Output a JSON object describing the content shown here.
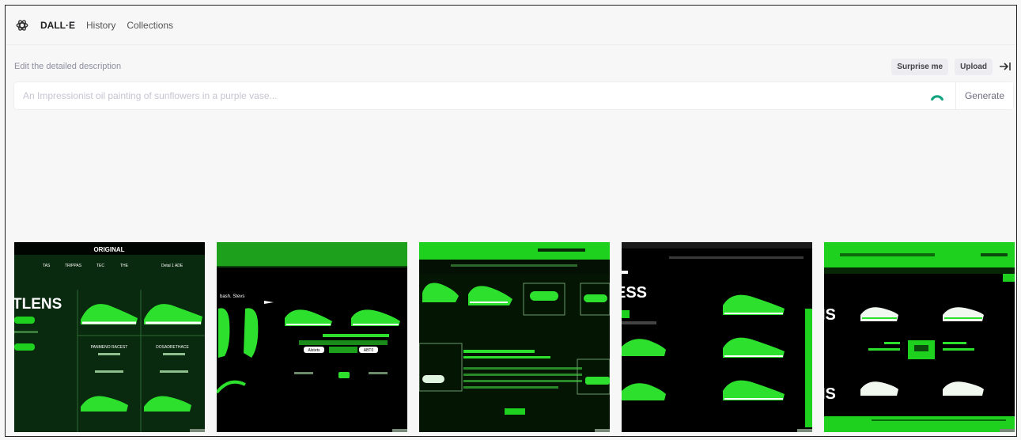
{
  "nav": {
    "brand": "DALL·E",
    "items": [
      "History",
      "Collections"
    ]
  },
  "prompt": {
    "label": "Edit the detailed description",
    "placeholder": "An Impressionist oil painting of sunflowers in a purple vase...",
    "value": "",
    "surprise_label": "Surprise me",
    "upload_label": "Upload",
    "generate_label": "Generate"
  },
  "results": {
    "tile1": {
      "header": "ORIGINAL",
      "menu": [
        "TAS",
        "TRIPPAS",
        "TEC",
        "THE",
        "Detal 1 ADE"
      ],
      "headline": "TLENS",
      "panel_a_title": "PANMENO RACEST",
      "panel_b_title": "DOSADRETHACE"
    },
    "tile2": {
      "caption": "bash. Stevs",
      "btn_a": "Alstets",
      "btn_b": "ABT0"
    },
    "tile4": {
      "headline": "ESS"
    },
    "tile5": {
      "headline_top": "IS",
      "headline_bottom": "IS"
    }
  },
  "icons": {
    "logo": "openai-logo-icon",
    "collapse": "collapse-sidebar-icon",
    "loading": "loading-spinner-icon"
  },
  "colors": {
    "accent_green": "#1fd11f",
    "spinner": "#10a37f",
    "tile_bg": "#020a02"
  }
}
